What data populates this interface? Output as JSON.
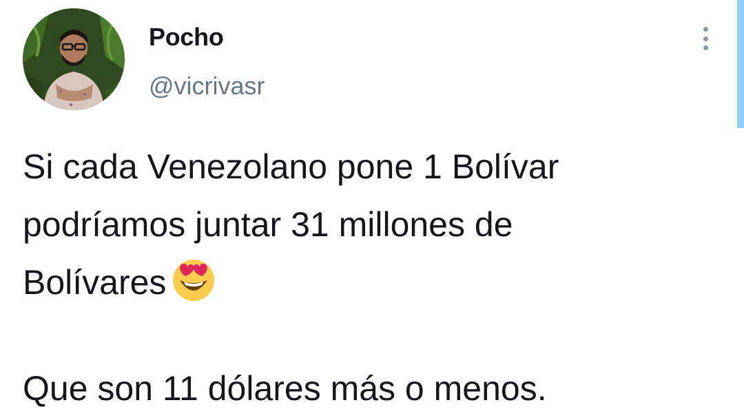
{
  "user": {
    "display_name": "Pocho",
    "handle": "@vicrivasr"
  },
  "tweet": {
    "lines": [
      "Si cada Venezolano pone 1 Bolívar",
      "podríamos juntar 31 millones de",
      "Bolívares",
      "Que son 11 dólares más o menos."
    ],
    "emoji": "heart-eyes-emoji-icon"
  },
  "colors": {
    "text": "#14171a",
    "secondary": "#657786",
    "scroll_indicator": "#8fd0f8"
  }
}
